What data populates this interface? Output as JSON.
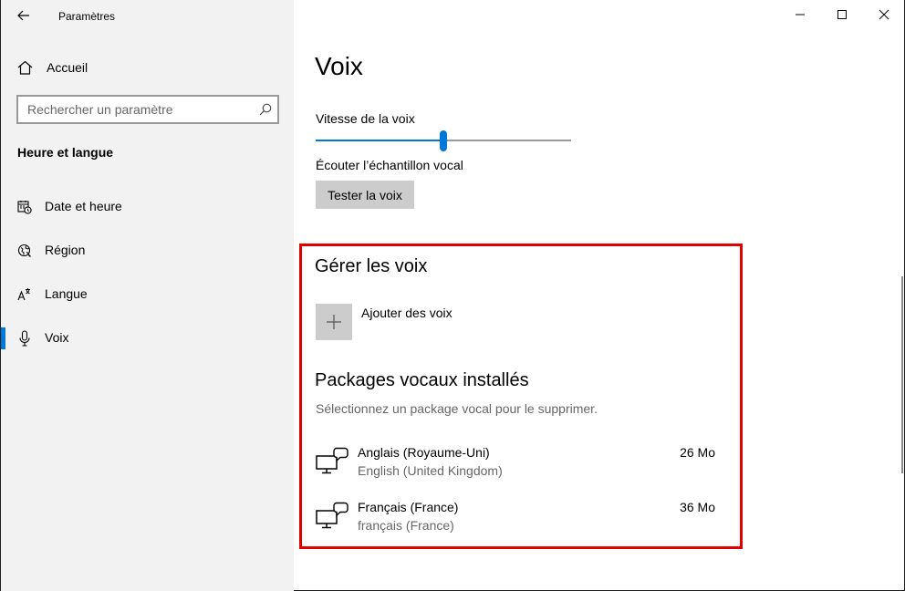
{
  "window": {
    "title": "Paramètres"
  },
  "sidebar": {
    "home_label": "Accueil",
    "search_placeholder": "Rechercher un paramètre",
    "section_title": "Heure et langue",
    "items": [
      {
        "label": "Date et heure",
        "icon": "calendar-clock-icon"
      },
      {
        "label": "Région",
        "icon": "globe-icon"
      },
      {
        "label": "Langue",
        "icon": "language-icon"
      },
      {
        "label": "Voix",
        "icon": "microphone-icon"
      }
    ],
    "active_item": "Voix"
  },
  "main": {
    "title": "Voix",
    "speed_label": "Vitesse de la voix",
    "speed_value": 0.5,
    "sample_label": "Écouter l’échantillon vocal",
    "test_button": "Tester la voix",
    "manage_title": "Gérer les voix",
    "add_voices_label": "Ajouter des voix",
    "installed_title": "Packages vocaux installés",
    "installed_subtitle": "Sélectionnez un package vocal pour le supprimer.",
    "packages": [
      {
        "name": "Anglais (Royaume-Uni)",
        "subtitle": "English (United Kingdom)",
        "size": "26 Mo"
      },
      {
        "name": "Français (France)",
        "subtitle": "français (France)",
        "size": "36 Mo"
      }
    ]
  },
  "colors": {
    "accent": "#0078d7",
    "highlight": "#e00000",
    "sidebar_bg": "#f2f2f2"
  }
}
